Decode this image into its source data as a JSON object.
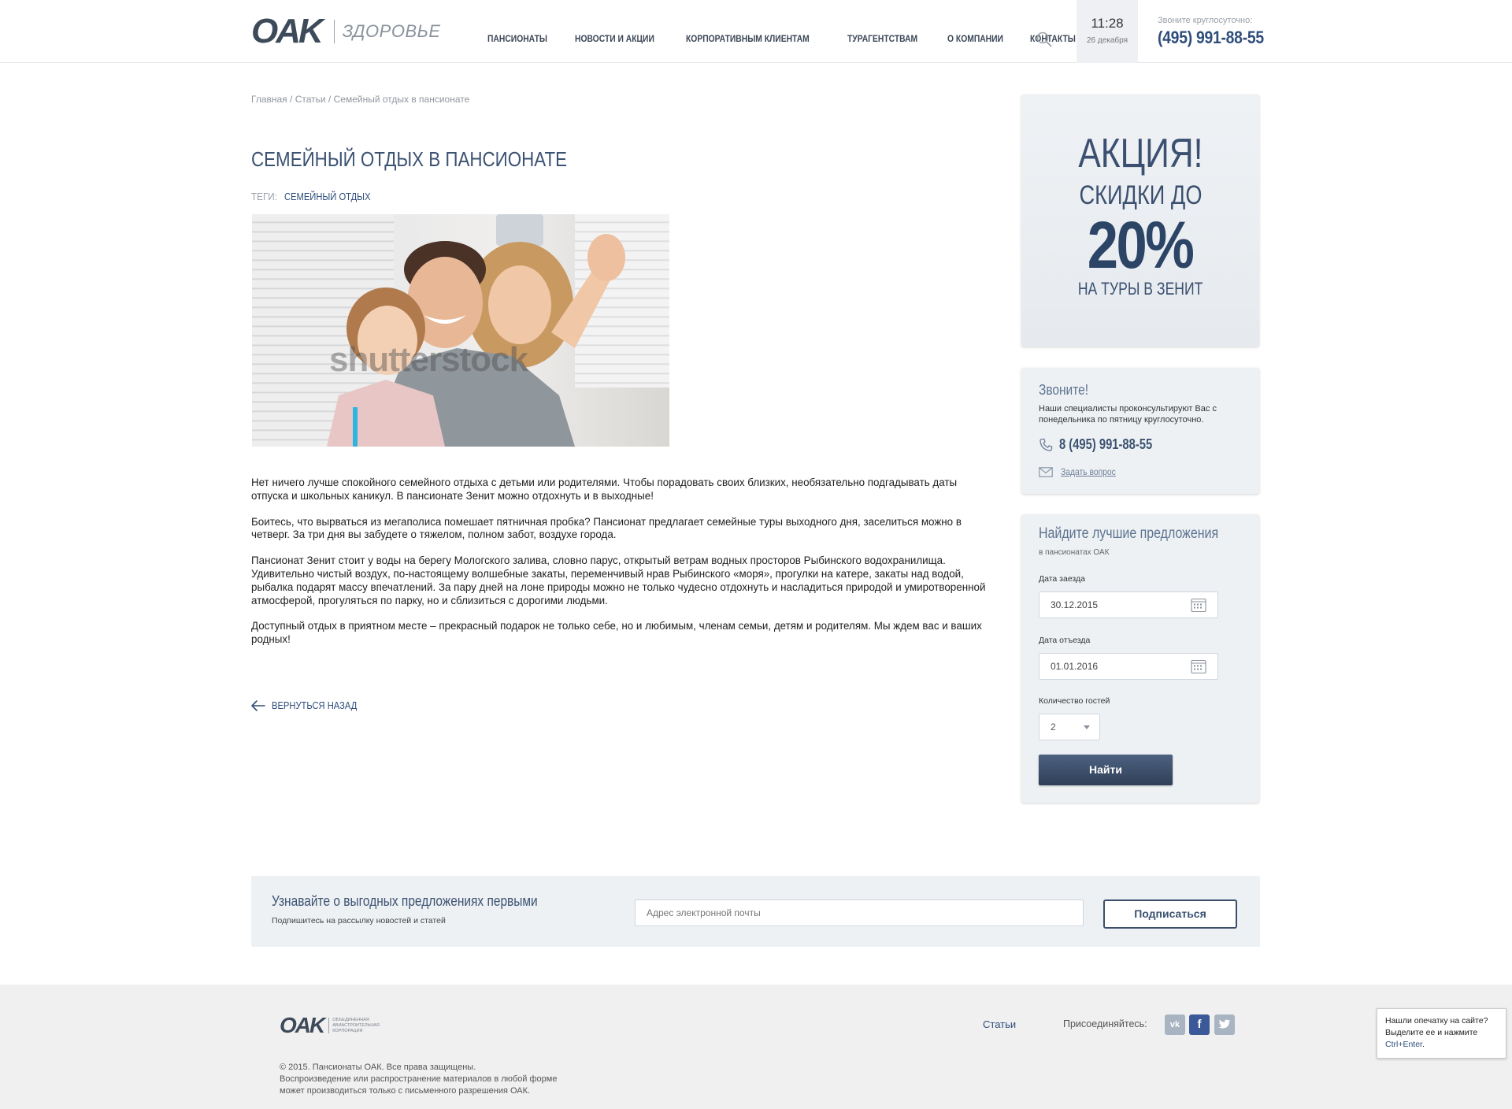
{
  "header": {
    "logo_mark": "OAK",
    "logo_sub": "ЗДОРОВЬЕ",
    "nav": [
      {
        "label": "ПАНСИОНАТЫ"
      },
      {
        "label": "НОВОСТИ И АКЦИИ"
      },
      {
        "label": "КОРПОРАТИВНЫМ КЛИЕНТАМ"
      },
      {
        "label": "ТУРАГЕНТСТВАМ"
      },
      {
        "label": "О КОМПАНИИ"
      },
      {
        "label": "КОНТАКТЫ"
      }
    ],
    "time": "11:28",
    "date": "26 декабря",
    "phone_caption": "Звоните круглосуточно:",
    "phone": "(495) 991-88-55"
  },
  "breadcrumb": {
    "home": "Главная",
    "articles": "Статьи",
    "current": "Семейный отдых в пансионате",
    "sep": " / "
  },
  "article": {
    "title": "СЕМЕЙНЫЙ ОТДЫХ В ПАНСИОНАТЕ",
    "tags_label": "ТЕГИ:",
    "tag": "СЕМЕЙНЫЙ ОТДЫХ",
    "image_watermark": "shutterstock",
    "paragraphs": [
      "Нет ничего лучше спокойного семейного отдыха с детьми или родителями. Чтобы порадовать своих близких, необязательно подгадывать даты отпуска и школьных каникул. В пансионате Зенит можно отдохнуть и в выходные!",
      "Боитесь, что вырваться из мегаполиса помешает пятничная пробка? Пансионат предлагает семейные туры выходного дня, заселиться можно в четверг. За три дня вы забудете о тяжелом, полном забот, воздухе города.",
      "Пансионат Зенит стоит у воды на берегу Мологского залива, словно парус, открытый ветрам водных просторов Рыбинского водохранилища. Удивительно чистый воздух, по-настоящему волшебные закаты, переменчивый нрав Рыбинского «моря», прогулки на катере, закаты над водой, рыбалка подарят массу впечатлений. За пару дней на лоне природы можно не только чудесно отдохнуть и насладиться природой и умиротворенной атмосферой, прогуляться по парку, но и сблизиться с дорогими людьми.",
      "Доступный отдых в приятном месте – прекрасный подарок не только себе, но и любимым, членам семьи, детям и родителям. Мы ждем вас и ваших родных!"
    ],
    "back_label": "ВЕРНУТЬСЯ НАЗАД"
  },
  "promo": {
    "line1": "АКЦИЯ!",
    "line2": "СКИДКИ ДО",
    "line3": "20%",
    "line4": "НА ТУРЫ В ЗЕНИТ"
  },
  "call": {
    "title": "Звоните!",
    "desc": "Наши специалисты проконсультируют Вас с понедельника по пятницу круглосуточно.",
    "phone": "8 (495) 991-88-55",
    "ask": "Задать вопрос"
  },
  "search": {
    "title": "Найдите лучшие предложения",
    "sub": "в пансионатах ОАК",
    "checkin_label": "Дата заезда",
    "checkin_value": "30.12.2015",
    "checkout_label": "Дата отъезда",
    "checkout_value": "01.01.2016",
    "guests_label": "Количество гостей",
    "guests_value": "2",
    "button": "Найти"
  },
  "subscribe": {
    "title": "Узнавайте о выгодных предложениях первыми",
    "sub": "Подпишитесь на рассылку новостей и статей",
    "placeholder": "Адрес электронной почты",
    "button": "Подписаться"
  },
  "footer": {
    "logo_mark": "OAK",
    "logo_text": "ОБЪЕДИНЕННАЯ АВИАСТРОИТЕЛЬНАЯ КОРПОРАЦИЯ",
    "copy1": "© 2015. Пансионаты ОАК. Все права защищены.",
    "copy2": "Воспроизведение или распространение материалов в любой форме",
    "copy3": "может производиться только с письменного разрешения ОАК.",
    "link": "Статьи",
    "join": "Присоединяйтесь:",
    "social_vk": "vk",
    "social_fb": "f"
  },
  "typo": {
    "line1": "Нашли опечатку на сайте?",
    "line2": "Выделите ее и нажмите",
    "hotkey": "Ctrl+Enter",
    "dot": "."
  },
  "colors": {
    "accent": "#2e4d7a",
    "button_dark": "#2f3f57",
    "panel": "#eef1f4",
    "footer": "#f0f0f0"
  }
}
